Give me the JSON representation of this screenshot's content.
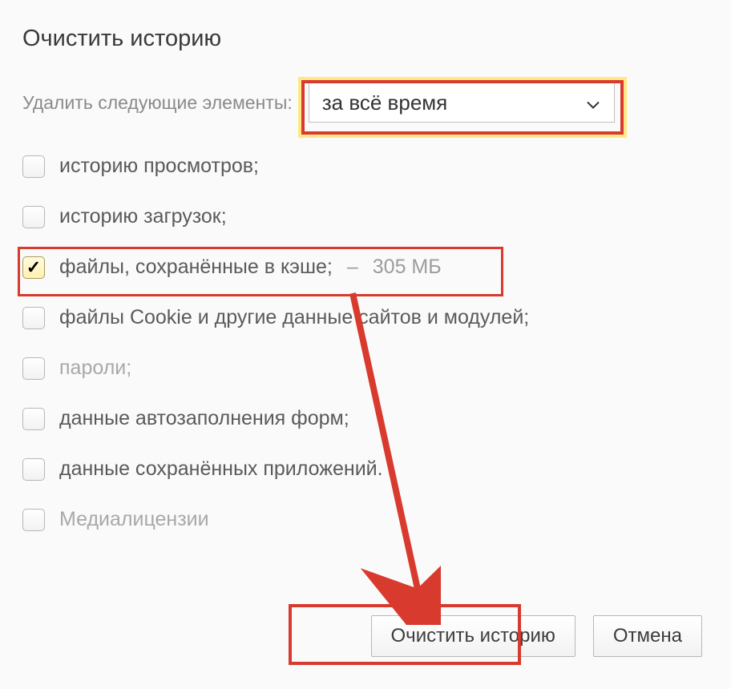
{
  "title": "Очистить историю",
  "range": {
    "label": "Удалить следующие элементы:",
    "selected": "за всё время"
  },
  "options": {
    "browsing": {
      "label": "историю просмотров;",
      "checked": false
    },
    "downloads": {
      "label": "историю загрузок;",
      "checked": false
    },
    "cache": {
      "label": "файлы, сохранённые в кэше;",
      "extra_dash": "–",
      "extra_size": "305 МБ",
      "checked": true
    },
    "cookies": {
      "label": "файлы Cookie и другие данные сайтов и модулей;",
      "checked": false
    },
    "passwords": {
      "label": "пароли;",
      "checked": false
    },
    "autofill": {
      "label": "данные автозаполнения форм;",
      "checked": false
    },
    "apps": {
      "label": "данные сохранённых приложений.",
      "checked": false
    },
    "media": {
      "label": "Медиалицензии",
      "checked": false
    }
  },
  "buttons": {
    "clear": "Очистить историю",
    "cancel": "Отмена"
  }
}
